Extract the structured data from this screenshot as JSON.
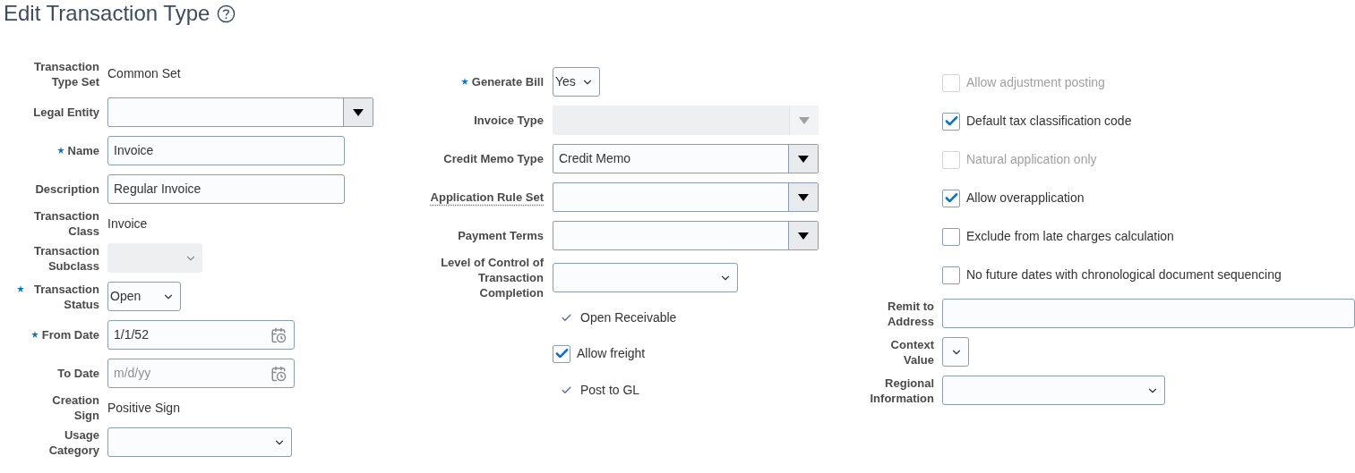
{
  "page": {
    "title": "Edit Transaction Type"
  },
  "columns": [
    {
      "rows": [
        {
          "kind": "text",
          "label": "Transaction Type Set",
          "value": "Common Set",
          "required": false
        },
        {
          "kind": "combo",
          "label": "Legal Entity",
          "value": "",
          "required": false,
          "disabled": false
        },
        {
          "kind": "input",
          "label": "Name",
          "value": "Invoice",
          "required": true
        },
        {
          "kind": "input",
          "label": "Description",
          "value": "Regular Invoice",
          "required": false
        },
        {
          "kind": "text",
          "label": "Transaction Class",
          "value": "Invoice",
          "required": false
        },
        {
          "kind": "select",
          "label": "Transaction Subclass",
          "value": "",
          "required": false,
          "disabled": true
        },
        {
          "kind": "select",
          "label": "Transaction Status",
          "value": "Open",
          "required": true,
          "disabled": false
        },
        {
          "kind": "date",
          "label": "From Date",
          "value": "1/1/52",
          "required": true
        },
        {
          "kind": "date",
          "label": "To Date",
          "placeholder": "m/d/yy",
          "required": false
        },
        {
          "kind": "text",
          "label": "Creation Sign",
          "value": "Positive Sign",
          "required": false
        },
        {
          "kind": "select",
          "label": "Usage Category",
          "value": "",
          "required": false,
          "disabled": false
        }
      ]
    },
    {
      "rows": [
        {
          "kind": "select",
          "label": "Generate Bill",
          "value": "Yes",
          "required": true,
          "disabled": false
        },
        {
          "kind": "combo",
          "label": "Invoice Type",
          "value": "",
          "required": false,
          "disabled": true
        },
        {
          "kind": "combo",
          "label": "Credit Memo Type",
          "value": "Credit Memo",
          "required": false,
          "disabled": false
        },
        {
          "kind": "combo",
          "label": "Application Rule Set",
          "value": "",
          "required": false,
          "disabled": false,
          "help": true
        },
        {
          "kind": "combo",
          "label": "Payment Terms",
          "value": "",
          "required": false,
          "disabled": false
        },
        {
          "kind": "select",
          "label": "Level of Control of Transaction Completion",
          "value": "",
          "required": false,
          "disabled": false
        },
        {
          "kind": "check",
          "label": "Open Receivable",
          "checked": true
        },
        {
          "kind": "checkbox",
          "label": "Allow freight",
          "checked": true,
          "disabled": false
        },
        {
          "kind": "check",
          "label": "Post to GL",
          "checked": true
        }
      ]
    },
    {
      "rows": [
        {
          "kind": "checkbox",
          "label": "Allow adjustment posting",
          "checked": false,
          "disabled": true
        },
        {
          "kind": "checkbox",
          "label": "Default tax classification code",
          "checked": true,
          "disabled": false
        },
        {
          "kind": "checkbox",
          "label": "Natural application only",
          "checked": false,
          "disabled": true
        },
        {
          "kind": "checkbox",
          "label": "Allow overapplication",
          "checked": true,
          "disabled": false
        },
        {
          "kind": "checkbox",
          "label": "Exclude from late charges calculation",
          "checked": false,
          "disabled": false
        },
        {
          "kind": "checkbox",
          "label": "No future dates with chronological document sequencing",
          "checked": false,
          "disabled": false
        },
        {
          "kind": "input",
          "label": "Remit to Address",
          "value": "",
          "required": false
        },
        {
          "kind": "select",
          "label": "Context Value",
          "value": "",
          "required": false,
          "disabled": false
        },
        {
          "kind": "select",
          "label": "Regional Information",
          "value": "",
          "required": false,
          "disabled": false
        }
      ]
    }
  ]
}
